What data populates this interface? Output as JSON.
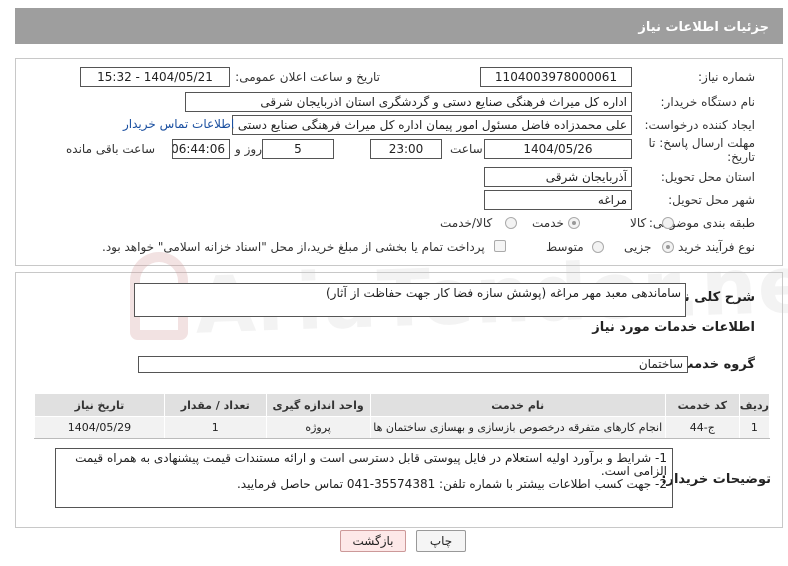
{
  "header": {
    "title": "جزئیات اطلاعات نیاز"
  },
  "fields": {
    "need_number_label": "شماره نیاز:",
    "need_number": "1104003978000061",
    "announce_label": "تاریخ و ساعت اعلان عمومی:",
    "announce_value": "1404/05/21 - 15:32",
    "buyer_org_label": "نام دستگاه خریدار:",
    "buyer_org": "اداره کل میراث فرهنگی  صنایع دستی و گردشگری استان اذربایجان شرقی",
    "requester_label": "ایجاد کننده درخواست:",
    "requester": "علی محمدزاده فاضل مسئول امور پیمان اداره کل میراث فرهنگی  صنایع دستی و",
    "buyer_contact_link": "اطلاعات تماس خریدار",
    "deadline_label_1": "مهلت ارسال پاسخ: تا",
    "deadline_label_2": "تاریخ:",
    "deadline_date": "1404/05/26",
    "time_label": "ساعت",
    "deadline_time": "23:00",
    "days_value": "5",
    "days_label": "روز و",
    "remaining_time": "06:44:06",
    "remaining_label": "ساعت باقی مانده",
    "province_label": "استان محل تحویل:",
    "province": "آذربایجان شرقی",
    "city_label": "شهر محل تحویل:",
    "city": "مراغه",
    "category_label": "طبقه بندی موضوعی:",
    "category_options": [
      "کالا",
      "خدمت",
      "کالا/خدمت"
    ],
    "category_selected": "خدمت",
    "process_label": "نوع فرآیند خرید :",
    "process_options": [
      "جزیی",
      "متوسط"
    ],
    "process_selected": "جزیی",
    "payment_note": "پرداخت تمام یا بخشی از مبلغ خرید،از محل \"اسناد خزانه اسلامی\" خواهد بود."
  },
  "description": {
    "label": "شرح کلی نیاز:",
    "value": "ساماندهی معبد مهر مراغه (پوشش سازه فضا کار جهت حفاظت از آثار)"
  },
  "services": {
    "section_title": "اطلاعات خدمات مورد نیاز",
    "group_label": "گروه خدمت:",
    "group_value": "ساختمان",
    "columns": [
      "ردیف",
      "کد خدمت",
      "نام خدمت",
      "واحد اندازه گیری",
      "تعداد / مقدار",
      "تاریخ نیاز"
    ],
    "rows": [
      [
        "1",
        "ج-44",
        "انجام کارهای متفرقه درخصوص بازسازی و بهسازی ساختمان ها",
        "پروژه",
        "1",
        "1404/05/29"
      ]
    ]
  },
  "notes": {
    "label": "توضیحات خریدار:",
    "line1": "1- شرایط و برآورد اولیه استعلام در فایل پیوستی قابل دسترسی است و ارائه مستندات قیمت پیشنهادی به همراه قیمت الزامی است.",
    "line2": "2- جهت کسب اطلاعات بیشتر  با شماره تلفن: 35574381-041  تماس حاصل فرمایید."
  },
  "buttons": {
    "print": "چاپ",
    "back": "بازگشت"
  },
  "watermark": "AriaTender.neT"
}
